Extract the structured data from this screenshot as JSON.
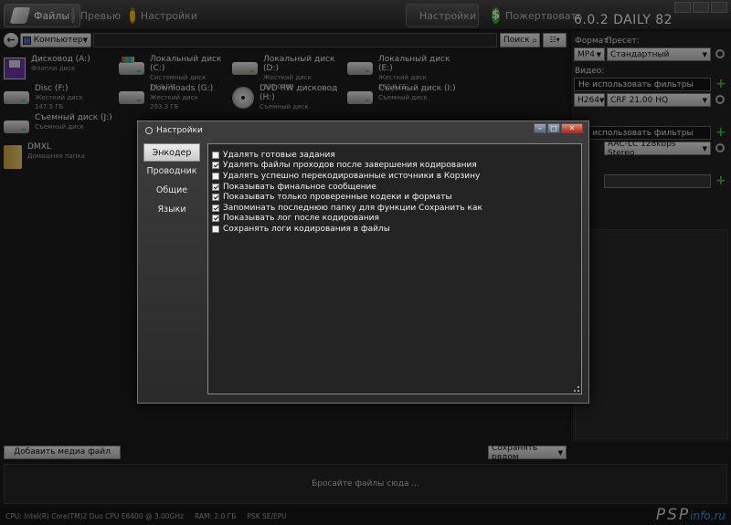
{
  "topbar": {
    "tabs": [
      {
        "label": "Файлы"
      },
      {
        "label": "Превью"
      },
      {
        "label": "Настройки"
      },
      {
        "label": "Настройки"
      },
      {
        "label": "Пожертвовать"
      }
    ],
    "version": "6.0.2 DAILY 82"
  },
  "nav": {
    "back_glyph": "←",
    "location": "Компьютер",
    "search_label": "Поиск"
  },
  "drives": [
    {
      "name": "Дисковод (A:)",
      "sub": "Флоппи диск",
      "icon": "floppy-icon"
    },
    {
      "name": "Локальный диск (C:)",
      "sub": "Системный диск\n24.9 ГБ",
      "line1": "Системный диск",
      "line2": "24.9 ГБ",
      "icon": "system-drive-icon"
    },
    {
      "name": "Локальный диск (D:)",
      "line1": "Жесткий диск",
      "line2": "100.0 МБ",
      "icon": "hard-drive-icon"
    },
    {
      "name": "Локальный диск (E:)",
      "line1": "Жесткий диск",
      "line2": "268.8 ГБ",
      "icon": "hard-drive-icon"
    },
    {
      "name": "Disc  (F:)",
      "line1": "Жесткий диск",
      "line2": "147.5 ГБ",
      "icon": "hard-drive-icon"
    },
    {
      "name": "Downloads (G:)",
      "line1": "Жесткий диск",
      "line2": "293.3 ГБ",
      "icon": "hard-drive-icon"
    },
    {
      "name": "DVD RW дисковод (H:)",
      "line1": "Съемный диск",
      "line2": "",
      "icon": "dvd-icon"
    },
    {
      "name": "Съемный диск (I:)",
      "line1": "Съемный диск",
      "line2": "",
      "icon": "hard-drive-icon"
    },
    {
      "name": "Съемный диск (J:)",
      "line1": "Съемный диск",
      "line2": "",
      "icon": "hard-drive-icon"
    },
    {
      "name": "DMXL",
      "line1": "Домашняя папка",
      "line2": "",
      "icon": "folder-icon"
    }
  ],
  "right": {
    "format_label": "Формат:",
    "preset_label": "Пресет:",
    "format_value": "MP4",
    "preset_value": "Стандартный",
    "video_label": "Видео:",
    "video_filter": "Не использовать фильтры",
    "video_codec": "H264",
    "video_quality": "CRF 21.00 HQ",
    "audio_filter": "Не использовать фильтры",
    "audio_codec": "AAC-LC 128kbps Stereo"
  },
  "bottom": {
    "add_label": "Добавить медиа файл",
    "save_label": "Сохранять рядом",
    "drop_text": "Бросайте файлы сюда ..."
  },
  "status": {
    "cpu": "CPU: Intel(R) Core(TM)2 Duo CPU  E8400 @ 3.00GHz",
    "ram": "RAM: 2.0 ГБ",
    "platform": "PSK SE/EPU"
  },
  "watermark": {
    "main": "PSP",
    "suffix": "info.ru"
  },
  "dialog": {
    "title": "Настройки",
    "menu": [
      "Энкодер",
      "Проводник",
      "Общие",
      "Языки"
    ],
    "options": [
      {
        "label": "Удалять готовые задания",
        "checked": false
      },
      {
        "label": "Удалять файлы проходов после завершения кодирования",
        "checked": true
      },
      {
        "label": "Удалять успешно перекодированные источники в Корзину",
        "checked": false
      },
      {
        "label": "Показывать финальное сообщение",
        "checked": true
      },
      {
        "label": "Показывать только проверенные кодеки и форматы",
        "checked": true
      },
      {
        "label": "Запоминать последнюю папку для функции Сохранить как",
        "checked": true
      },
      {
        "label": "Показывать лог после кодирования",
        "checked": true
      },
      {
        "label": "Сохранять логи кодирования в файлы",
        "checked": false
      }
    ]
  }
}
